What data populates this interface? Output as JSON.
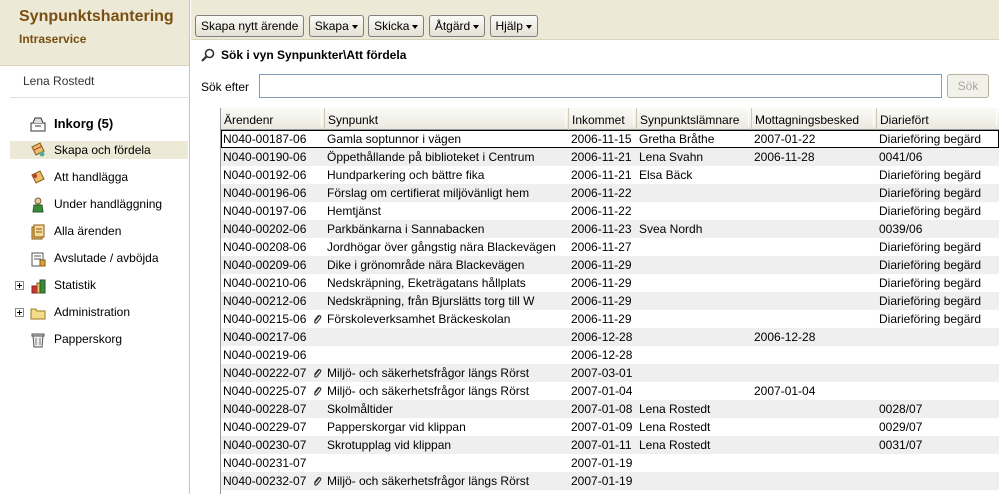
{
  "app": {
    "title": "Synpunktshantering",
    "subtitle": "Intraservice"
  },
  "user": {
    "name": "Lena Rostedt"
  },
  "sidebar": {
    "items": [
      {
        "label": "Inkorg (5)",
        "icon": "inbox-icon"
      },
      {
        "label": "Skapa och fördela",
        "icon": "create-distribute-icon",
        "selected": true
      },
      {
        "label": "Att handlägga",
        "icon": "to-handle-icon"
      },
      {
        "label": "Under handläggning",
        "icon": "person-icon"
      },
      {
        "label": "Alla ärenden",
        "icon": "all-cases-icon"
      },
      {
        "label": "Avslutade / avböjda",
        "icon": "closed-cases-icon"
      },
      {
        "label": "Statistik",
        "icon": "statistics-icon",
        "expandable": true
      },
      {
        "label": "Administration",
        "icon": "folder-icon",
        "expandable": true
      },
      {
        "label": "Papperskorg",
        "icon": "trash-icon"
      }
    ]
  },
  "toolbar": {
    "create_new_case": "Skapa nytt ärende",
    "create": "Skapa",
    "send": "Skicka",
    "action": "Åtgärd",
    "help": "Hjälp"
  },
  "search": {
    "title": "Sök i vyn Synpunkter\\Att fördela",
    "label": "Sök efter",
    "value": "",
    "button": "Sök"
  },
  "table": {
    "columns": [
      "Ärendenr",
      "Synpunkt",
      "Inkommet",
      "Synpunktslämnare",
      "Mottagningsbesked",
      "Diariefört"
    ],
    "rows": [
      [
        "N040-00187-06",
        "Gamla soptunnor i vägen",
        "2006-11-15",
        "Gretha Bråthe",
        "2007-01-22",
        "Diarieföring begärd",
        false
      ],
      [
        "N040-00190-06",
        "Öppethållande på biblioteket i Centrum",
        "2006-11-21",
        "Lena Svahn",
        "2006-11-28",
        "0041/06",
        false
      ],
      [
        "N040-00192-06",
        "Hundparkering och bättre fika",
        "2006-11-21",
        "Elsa Bäck",
        "",
        "Diarieföring begärd",
        false
      ],
      [
        "N040-00196-06",
        "Förslag om certifierat miljövänligt hem",
        "2006-11-22",
        "",
        "",
        "Diarieföring begärd",
        false
      ],
      [
        "N040-00197-06",
        "Hemtjänst",
        "2006-11-22",
        "",
        "",
        "Diarieföring begärd",
        false
      ],
      [
        "N040-00202-06",
        "Parkbänkarna i Sannabacken",
        "2006-11-23",
        "Svea Nordh",
        "",
        "0039/06",
        false
      ],
      [
        "N040-00208-06",
        "Jordhögar över gångstig nära Blackevägen",
        "2006-11-27",
        "",
        "",
        "Diarieföring begärd",
        false
      ],
      [
        "N040-00209-06",
        "Dike i grönområde nära Blackevägen",
        "2006-11-29",
        "",
        "",
        "Diarieföring begärd",
        false
      ],
      [
        "N040-00210-06",
        "Nedskräpning, Eketrägatans hållplats",
        "2006-11-29",
        "",
        "",
        "Diarieföring begärd",
        false
      ],
      [
        "N040-00212-06",
        "Nedskräpning, från Bjurslätts torg till W",
        "2006-11-29",
        "",
        "",
        "Diarieföring begärd",
        false
      ],
      [
        "N040-00215-06",
        "Förskoleverksamhet Bräckeskolan",
        "2006-11-29",
        "",
        "",
        "Diarieföring begärd",
        true
      ],
      [
        "N040-00217-06",
        "",
        "2006-12-28",
        "",
        "2006-12-28",
        "",
        false
      ],
      [
        "N040-00219-06",
        "",
        "2006-12-28",
        "",
        "",
        "",
        false
      ],
      [
        "N040-00222-07",
        "Miljö- och säkerhetsfrågor längs Rörst",
        "2007-03-01",
        "",
        "",
        "",
        true
      ],
      [
        "N040-00225-07",
        "Miljö- och säkerhetsfrågor längs Rörst",
        "2007-01-04",
        "",
        "2007-01-04",
        "",
        true
      ],
      [
        "N040-00228-07",
        "Skolmåltider",
        "2007-01-08",
        "Lena  Rostedt",
        "",
        "0028/07",
        false
      ],
      [
        "N040-00229-07",
        "Papperskorgar vid klippan",
        "2007-01-09",
        "Lena Rostedt",
        "",
        "0029/07",
        false
      ],
      [
        "N040-00230-07",
        "Skrotupplag vid klippan",
        "2007-01-11",
        "Lena Rostedt",
        "",
        "0031/07",
        false
      ],
      [
        "N040-00231-07",
        "",
        "2007-01-19",
        "",
        "",
        "",
        false
      ],
      [
        "N040-00232-07",
        "Miljö- och säkerhetsfrågor längs Rörst",
        "2007-01-19",
        "",
        "",
        "",
        true
      ]
    ]
  },
  "colors": {
    "header_bg": "#ecead6",
    "title": "#7a4e12",
    "row_alt": "#efefef"
  }
}
